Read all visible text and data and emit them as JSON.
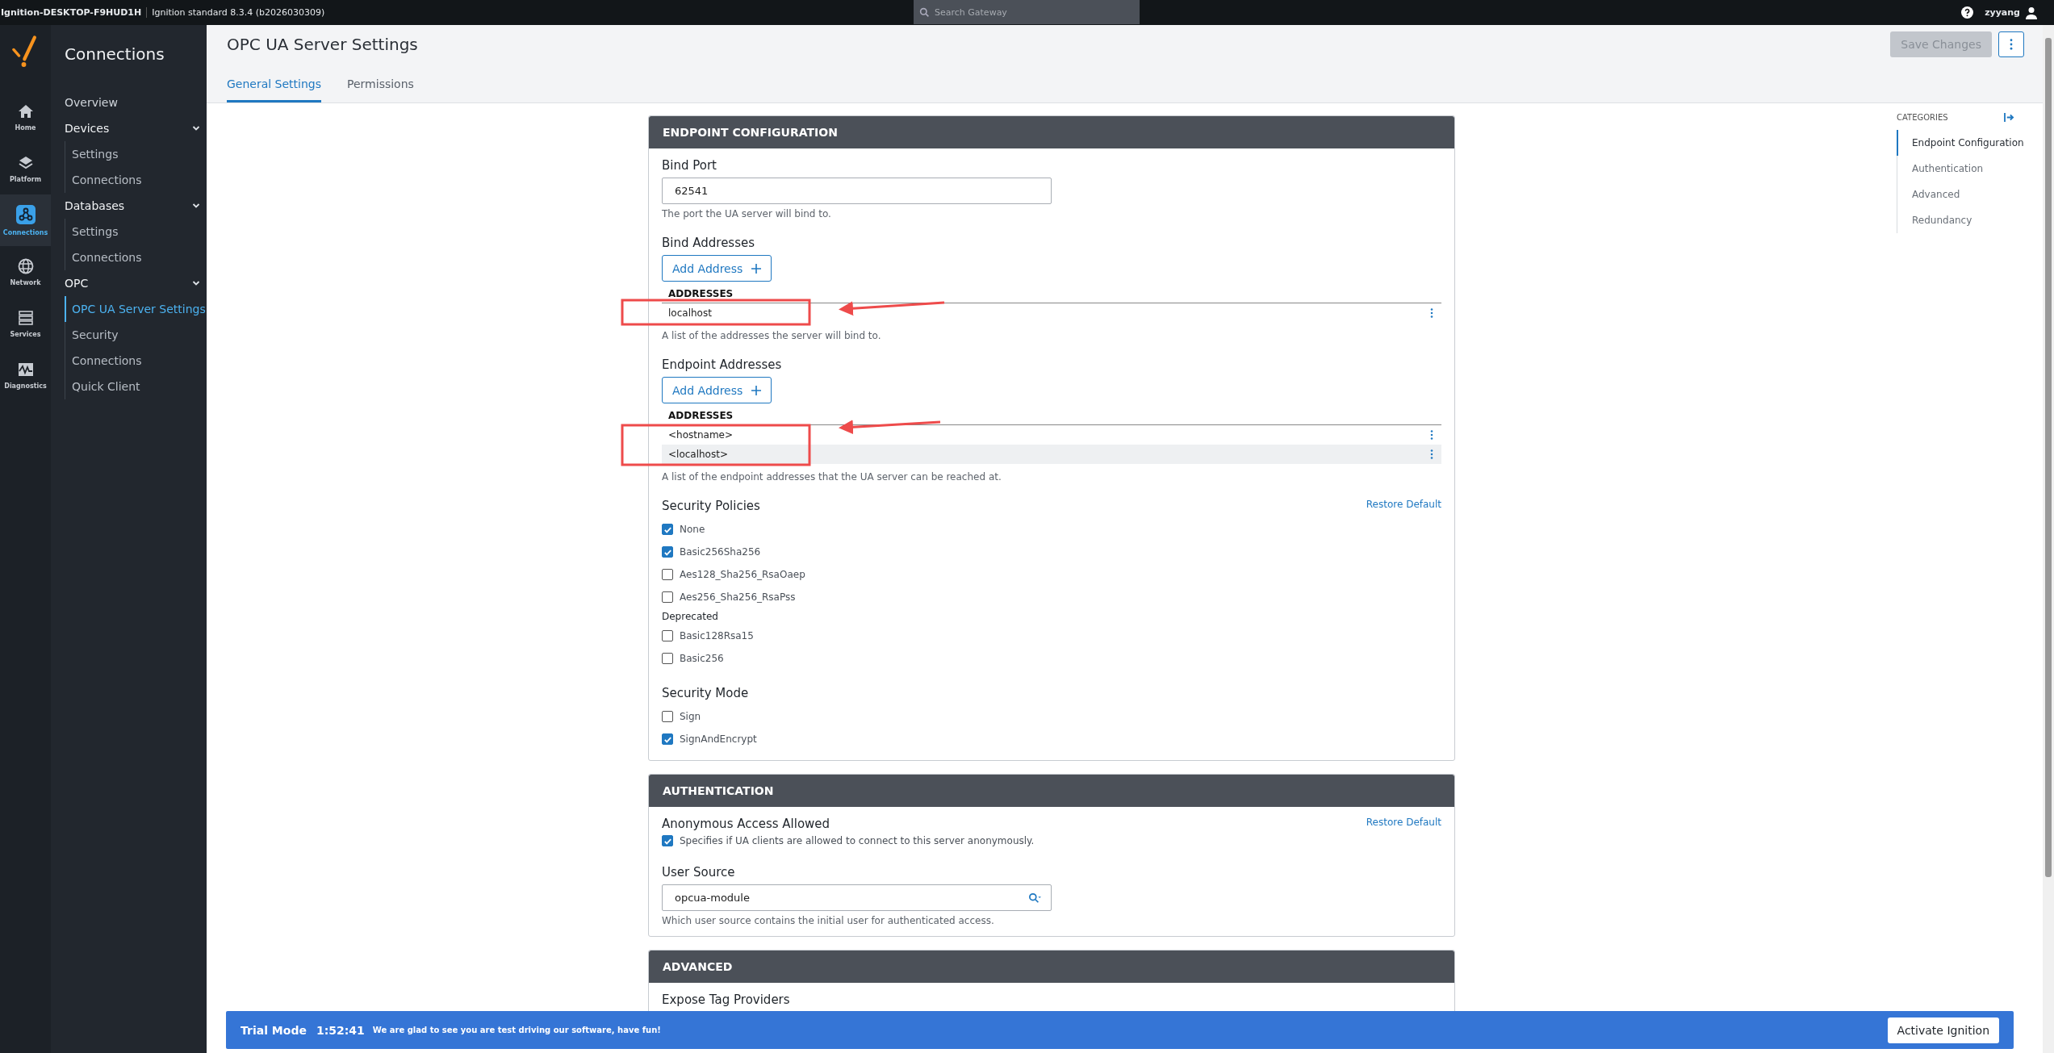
{
  "top_bar": {
    "gateway": "Ignition-DESKTOP-F9HUD1H",
    "edition": "Ignition standard 8.3.4 (b2026030309)",
    "search": {
      "placeholder": "Search Gateway"
    },
    "user": "zyyang"
  },
  "rail": [
    {
      "label": "Home",
      "selected": false
    },
    {
      "label": "Platform",
      "selected": false
    },
    {
      "label": "Connections",
      "selected": true
    },
    {
      "label": "Network",
      "selected": false
    },
    {
      "label": "Services",
      "selected": false
    },
    {
      "label": "Diagnostics",
      "selected": false
    }
  ],
  "sidebar": {
    "title": "Connections",
    "items": [
      {
        "label": "Overview"
      },
      {
        "label": "Devices",
        "expanded": true,
        "children": [
          {
            "label": "Settings",
            "selected": false
          },
          {
            "label": "Connections",
            "selected": false
          }
        ]
      },
      {
        "label": "Databases",
        "expanded": true,
        "children": [
          {
            "label": "Settings",
            "selected": false
          },
          {
            "label": "Connections",
            "selected": false
          }
        ]
      },
      {
        "label": "OPC",
        "expanded": true,
        "children": [
          {
            "label": "OPC UA Server Settings",
            "selected": true
          },
          {
            "label": "Security",
            "selected": false
          },
          {
            "label": "Connections",
            "selected": false
          },
          {
            "label": "Quick Client",
            "selected": false
          }
        ]
      }
    ]
  },
  "page": {
    "title": "OPC UA Server Settings",
    "save_button": {
      "label": "Save Changes",
      "disabled": true
    },
    "tabs": [
      {
        "label": "General Settings",
        "selected": true
      },
      {
        "label": "Permissions",
        "selected": false
      }
    ]
  },
  "sections": [
    {
      "title": "ENDPOINT CONFIGURATION",
      "fields": [
        {
          "kind": "text",
          "label": "Bind Port",
          "value": "62541",
          "help": "The port the UA server will bind to."
        },
        {
          "kind": "list",
          "label": "Bind Addresses",
          "button": "Add Address",
          "column": "ADDRESSES",
          "rows": [
            "localhost"
          ],
          "help": "A list of the addresses the server will bind to."
        },
        {
          "kind": "list",
          "label": "Endpoint Addresses",
          "button": "Add Address",
          "column": "ADDRESSES",
          "rows": [
            "<hostname>",
            "<localhost>"
          ],
          "help": "A list of the endpoint addresses that the UA server can be reached at."
        },
        {
          "kind": "checks",
          "label": "Security Policies",
          "restore": "Restore Default",
          "options": [
            {
              "kind": "check",
              "label": "None",
              "checked": true
            },
            {
              "kind": "check",
              "label": "Basic256Sha256",
              "checked": true
            },
            {
              "kind": "check",
              "label": "Aes128_Sha256_RsaOaep",
              "checked": false
            },
            {
              "kind": "check",
              "label": "Aes256_Sha256_RsaPss",
              "checked": false
            },
            {
              "kind": "heading",
              "label": "Deprecated"
            },
            {
              "kind": "check",
              "label": "Basic128Rsa15",
              "checked": false
            },
            {
              "kind": "check",
              "label": "Basic256",
              "checked": false
            }
          ]
        },
        {
          "kind": "checks",
          "label": "Security Mode",
          "options": [
            {
              "kind": "check",
              "label": "Sign",
              "checked": false
            },
            {
              "kind": "check",
              "label": "SignAndEncrypt",
              "checked": true
            }
          ]
        }
      ]
    },
    {
      "title": "AUTHENTICATION",
      "fields": [
        {
          "kind": "toggle",
          "label": "Anonymous Access Allowed",
          "restore": "Restore Default",
          "checked": true,
          "help": "Specifies if UA clients are allowed to connect to this server anonymously."
        },
        {
          "kind": "lookup",
          "label": "User Source",
          "value": "opcua-module",
          "help": "Which user source contains the initial user for authenticated access."
        }
      ]
    },
    {
      "title": "ADVANCED",
      "fields": [
        {
          "kind": "label",
          "label": "Expose Tag Providers"
        }
      ]
    }
  ],
  "categories": {
    "title": "CATEGORIES",
    "items": [
      {
        "label": "Endpoint Configuration",
        "selected": true
      },
      {
        "label": "Authentication",
        "selected": false
      },
      {
        "label": "Advanced",
        "selected": false
      },
      {
        "label": "Redundancy",
        "selected": false
      }
    ]
  },
  "trial_banner": {
    "title": "Trial Mode",
    "time": "1:52:41",
    "message": "We are glad to see you are test driving our software, have fun!",
    "button": "Activate Ignition"
  }
}
